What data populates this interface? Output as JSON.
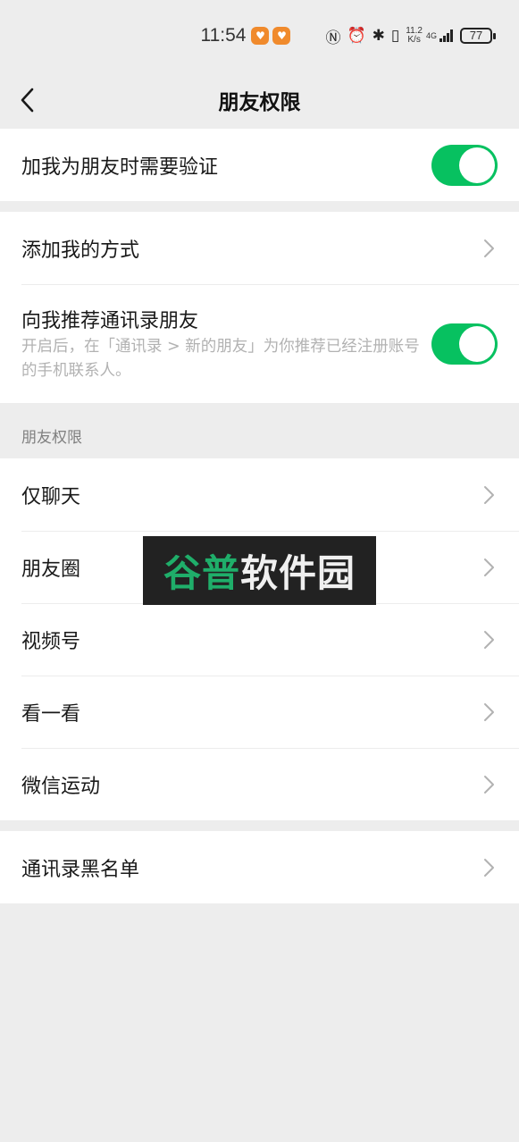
{
  "status_bar": {
    "time": "11:54",
    "network_speed_value": "11.2",
    "network_speed_unit": "K/s",
    "network_type": "4G",
    "battery": "77"
  },
  "nav": {
    "title": "朋友权限"
  },
  "verify": {
    "label": "加我为朋友时需要验证",
    "enabled": true
  },
  "add_methods": {
    "label": "添加我的方式"
  },
  "recommend": {
    "label": "向我推荐通讯录朋友",
    "description": "开启后，在「通讯录 > 新的朋友」为你推荐已经注册账号的手机联系人。",
    "enabled": true
  },
  "friend_permissions": {
    "header": "朋友权限",
    "items": [
      {
        "label": "仅聊天"
      },
      {
        "label": "朋友圈"
      },
      {
        "label": "视频号"
      },
      {
        "label": "看一看"
      },
      {
        "label": "微信运动"
      }
    ]
  },
  "blacklist": {
    "label": "通讯录黑名单"
  },
  "watermark": {
    "part1": "谷普",
    "part2": "软件园"
  },
  "colors": {
    "toggle_on": "#07c160",
    "background": "#ededed",
    "watermark_bg": "#222222",
    "watermark_green": "#1fae6a"
  }
}
